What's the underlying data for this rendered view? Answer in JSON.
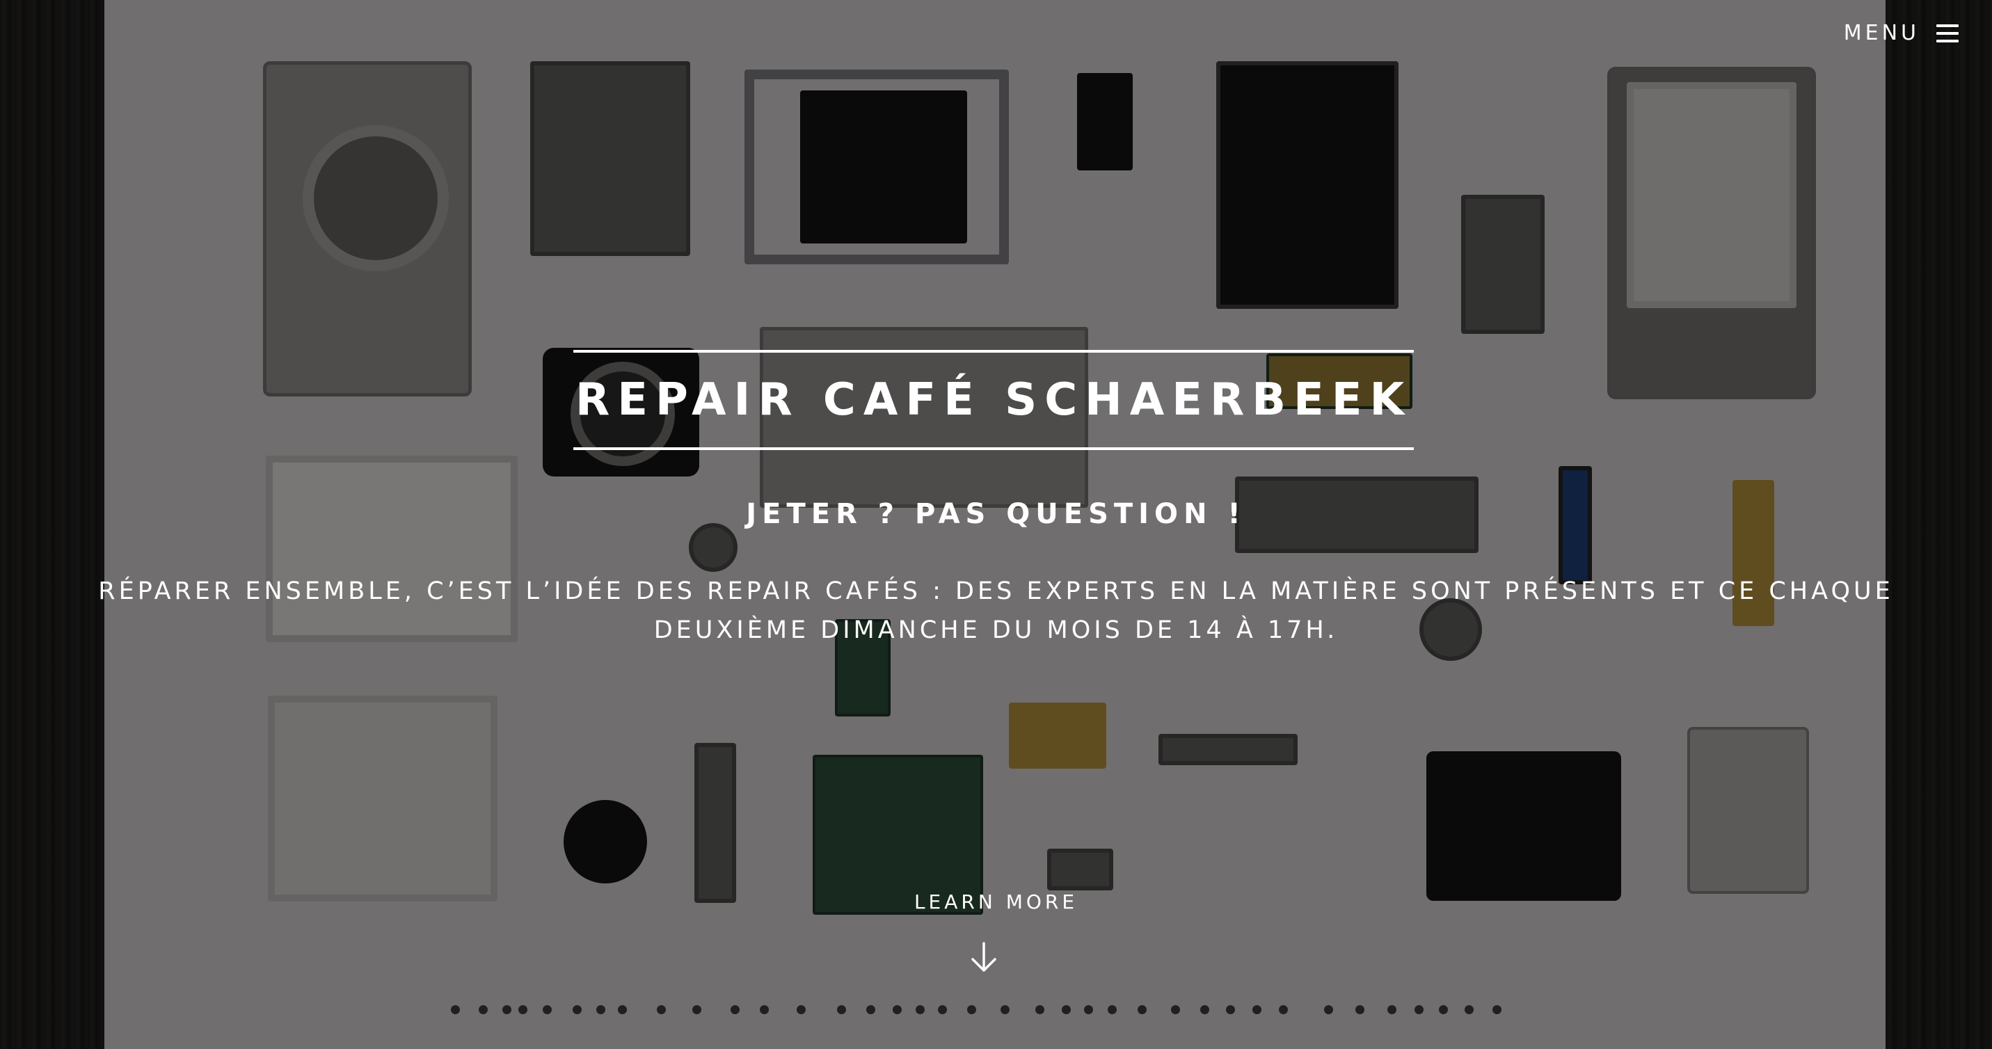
{
  "header": {
    "menu_label": "MENU",
    "menu_icon": "hamburger-icon"
  },
  "hero": {
    "title": "REPAIR CAFÉ SCHAERBEEK",
    "subtitle": "JETER ? PAS QUESTION !",
    "description": "RÉPARER ENSEMBLE, C’EST L’IDÉE DES REPAIR CAFÉS : DES EXPERTS EN LA MATIÈRE SONT PRÉSENTS ET CE CHAQUE DEUXIÈME DIMANCHE DU MOIS DE 14 À 17H.",
    "learn_more_label": "LEARN MORE",
    "scroll_icon": "arrow-down-icon",
    "background_image": "disassembled-camera-parts-photo"
  },
  "colors": {
    "text": "#ffffff",
    "overlay": "#000000"
  }
}
